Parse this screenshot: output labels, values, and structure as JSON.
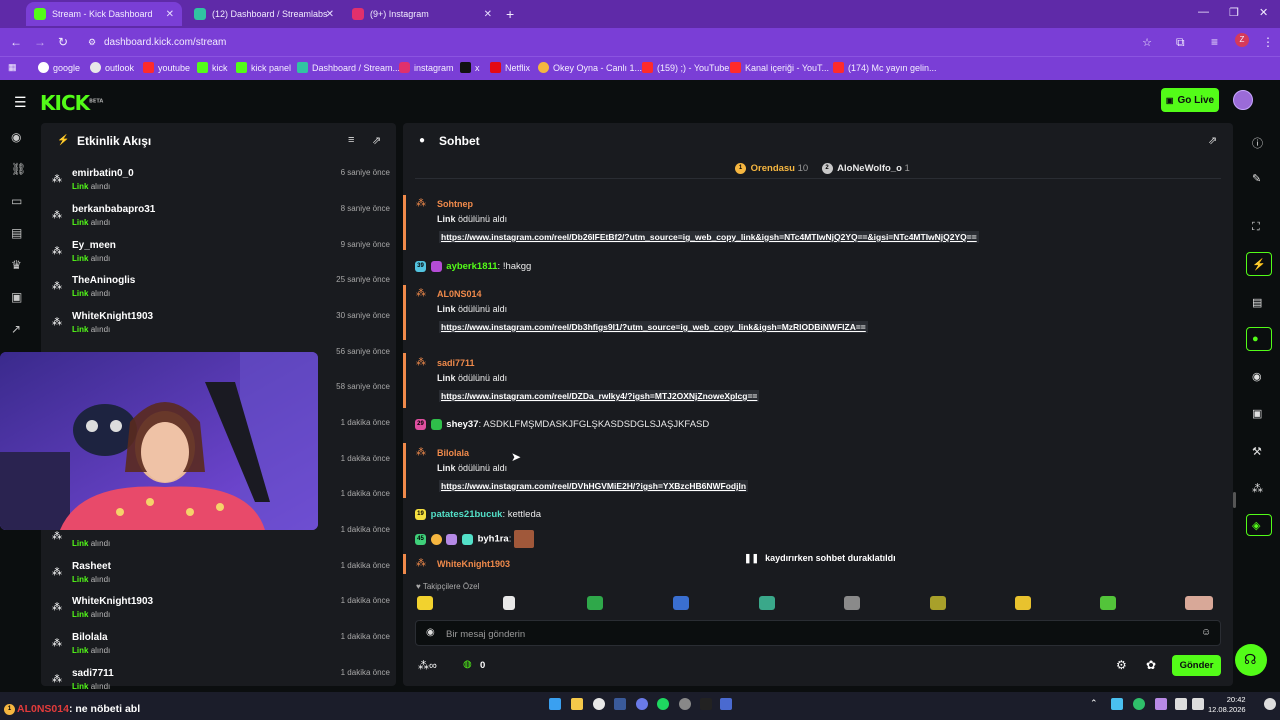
{
  "browser": {
    "tabs": [
      {
        "label": "Stream - Kick Dashboard",
        "active": true
      },
      {
        "label": "(12) Dashboard / Streamlabs",
        "active": false
      },
      {
        "label": "(9+) Instagram",
        "active": false
      }
    ],
    "url": "dashboard.kick.com/stream",
    "profile_initial": "Z",
    "bookmarks": [
      "google",
      "outlook",
      "youtube",
      "kick",
      "kick panel",
      "Dashboard / Stream...",
      "instagram",
      "x",
      "Netflix",
      "Okey Oyna - Canlı 1...",
      "(159) ;) - YouTube",
      "Kanal içeriği - YouT...",
      "(174) Mc yayın gelin..."
    ]
  },
  "header": {
    "logo": "KICK",
    "logo_tag": "BETA",
    "go_live_label": "Go Live"
  },
  "activity": {
    "title": "Etkinlik Akışı",
    "event_label": "Link",
    "event_suffix": "alındı",
    "items": [
      {
        "name": "emirbatin0_0",
        "time": "6 saniye önce"
      },
      {
        "name": "berkanbabapro31",
        "time": "8 saniye önce"
      },
      {
        "name": "Ey_meen",
        "time": "9 saniye önce"
      },
      {
        "name": "TheAninoglis",
        "time": "25 saniye önce"
      },
      {
        "name": "WhiteKnight1903",
        "time": "30 saniye önce"
      },
      {
        "name": "",
        "time": "56 saniye önce"
      },
      {
        "name": "",
        "time": "58 saniye önce"
      },
      {
        "name": "",
        "time": "1 dakika önce"
      },
      {
        "name": "",
        "time": "1 dakika önce"
      },
      {
        "name": "",
        "time": "1 dakika önce"
      },
      {
        "name": "",
        "time": "1 dakika önce"
      },
      {
        "name": "Rasheet",
        "time": "1 dakika önce"
      },
      {
        "name": "WhiteKnight1903",
        "time": "1 dakika önce"
      },
      {
        "name": "Bilolala",
        "time": "1 dakika önce"
      },
      {
        "name": "sadi7711",
        "time": "1 dakika önce"
      }
    ]
  },
  "chat": {
    "title": "Sohbet",
    "top_gifters": [
      {
        "rank": "1",
        "name": "Orendasu",
        "count": "10"
      },
      {
        "rank": "2",
        "name": "AloNeWolfo_o",
        "count": "1"
      }
    ],
    "reward_text": "ödülünü aldı",
    "reward_name": "Link",
    "redeems": [
      {
        "user": "Sohtnep",
        "link": "https://www.instagram.com/reel/Db26IFEtBf2/?utm_source=ig_web_copy_link&igsh=NTc4MTIwNjQ2YQ==&igsi=NTc4MTIwNjQ2YQ=="
      },
      {
        "user": "AL0NS014",
        "link": "https://www.instagram.com/reel/Db3hfigs9I1/?utm_source=ig_web_copy_link&igsh=MzRlODBiNWFlZA=="
      },
      {
        "user": "sadi7711",
        "link": "https://www.instagram.com/reel/DZDa_rwlky4/?igsh=MTJ2OXNjZnoweXplcg=="
      },
      {
        "user": "Bilolala",
        "link": "https://www.instagram.com/reel/DVhHGVMiE2H/?igsh=YXBzcHB6NWFodjln"
      },
      {
        "user": "WhiteKnight1903",
        "link": ""
      }
    ],
    "messages": [
      {
        "badge": "39",
        "user": "ayberk1811",
        "text": "!hakgg"
      },
      {
        "badge": "29",
        "user": "shey37",
        "text": "ASDKLFMŞMDASKJFGLŞKASDSDGLSJAŞJKFASD"
      },
      {
        "badge": "19",
        "user": "patates21bucuk",
        "text": "kettleda"
      },
      {
        "badge": "45",
        "user": "byh1ra",
        "text": ""
      }
    ],
    "paused_text": "kaydırırken sohbet duraklatıldı",
    "emote_section": "Takipçilere Özel",
    "input_placeholder": "Bir mesaj gönderin",
    "points": "0",
    "send_label": "Gönder"
  },
  "taskbar": {
    "ticker_user": "AL0NS014",
    "ticker_text": ": ne nöbeti abl",
    "time": "20:42",
    "date": "12.08.2026"
  },
  "colors": {
    "kick_green": "#53fc18",
    "browser_purple": "#7a3ed6",
    "redeem_orange": "#f08a4b",
    "panel_bg": "#191b1f"
  }
}
